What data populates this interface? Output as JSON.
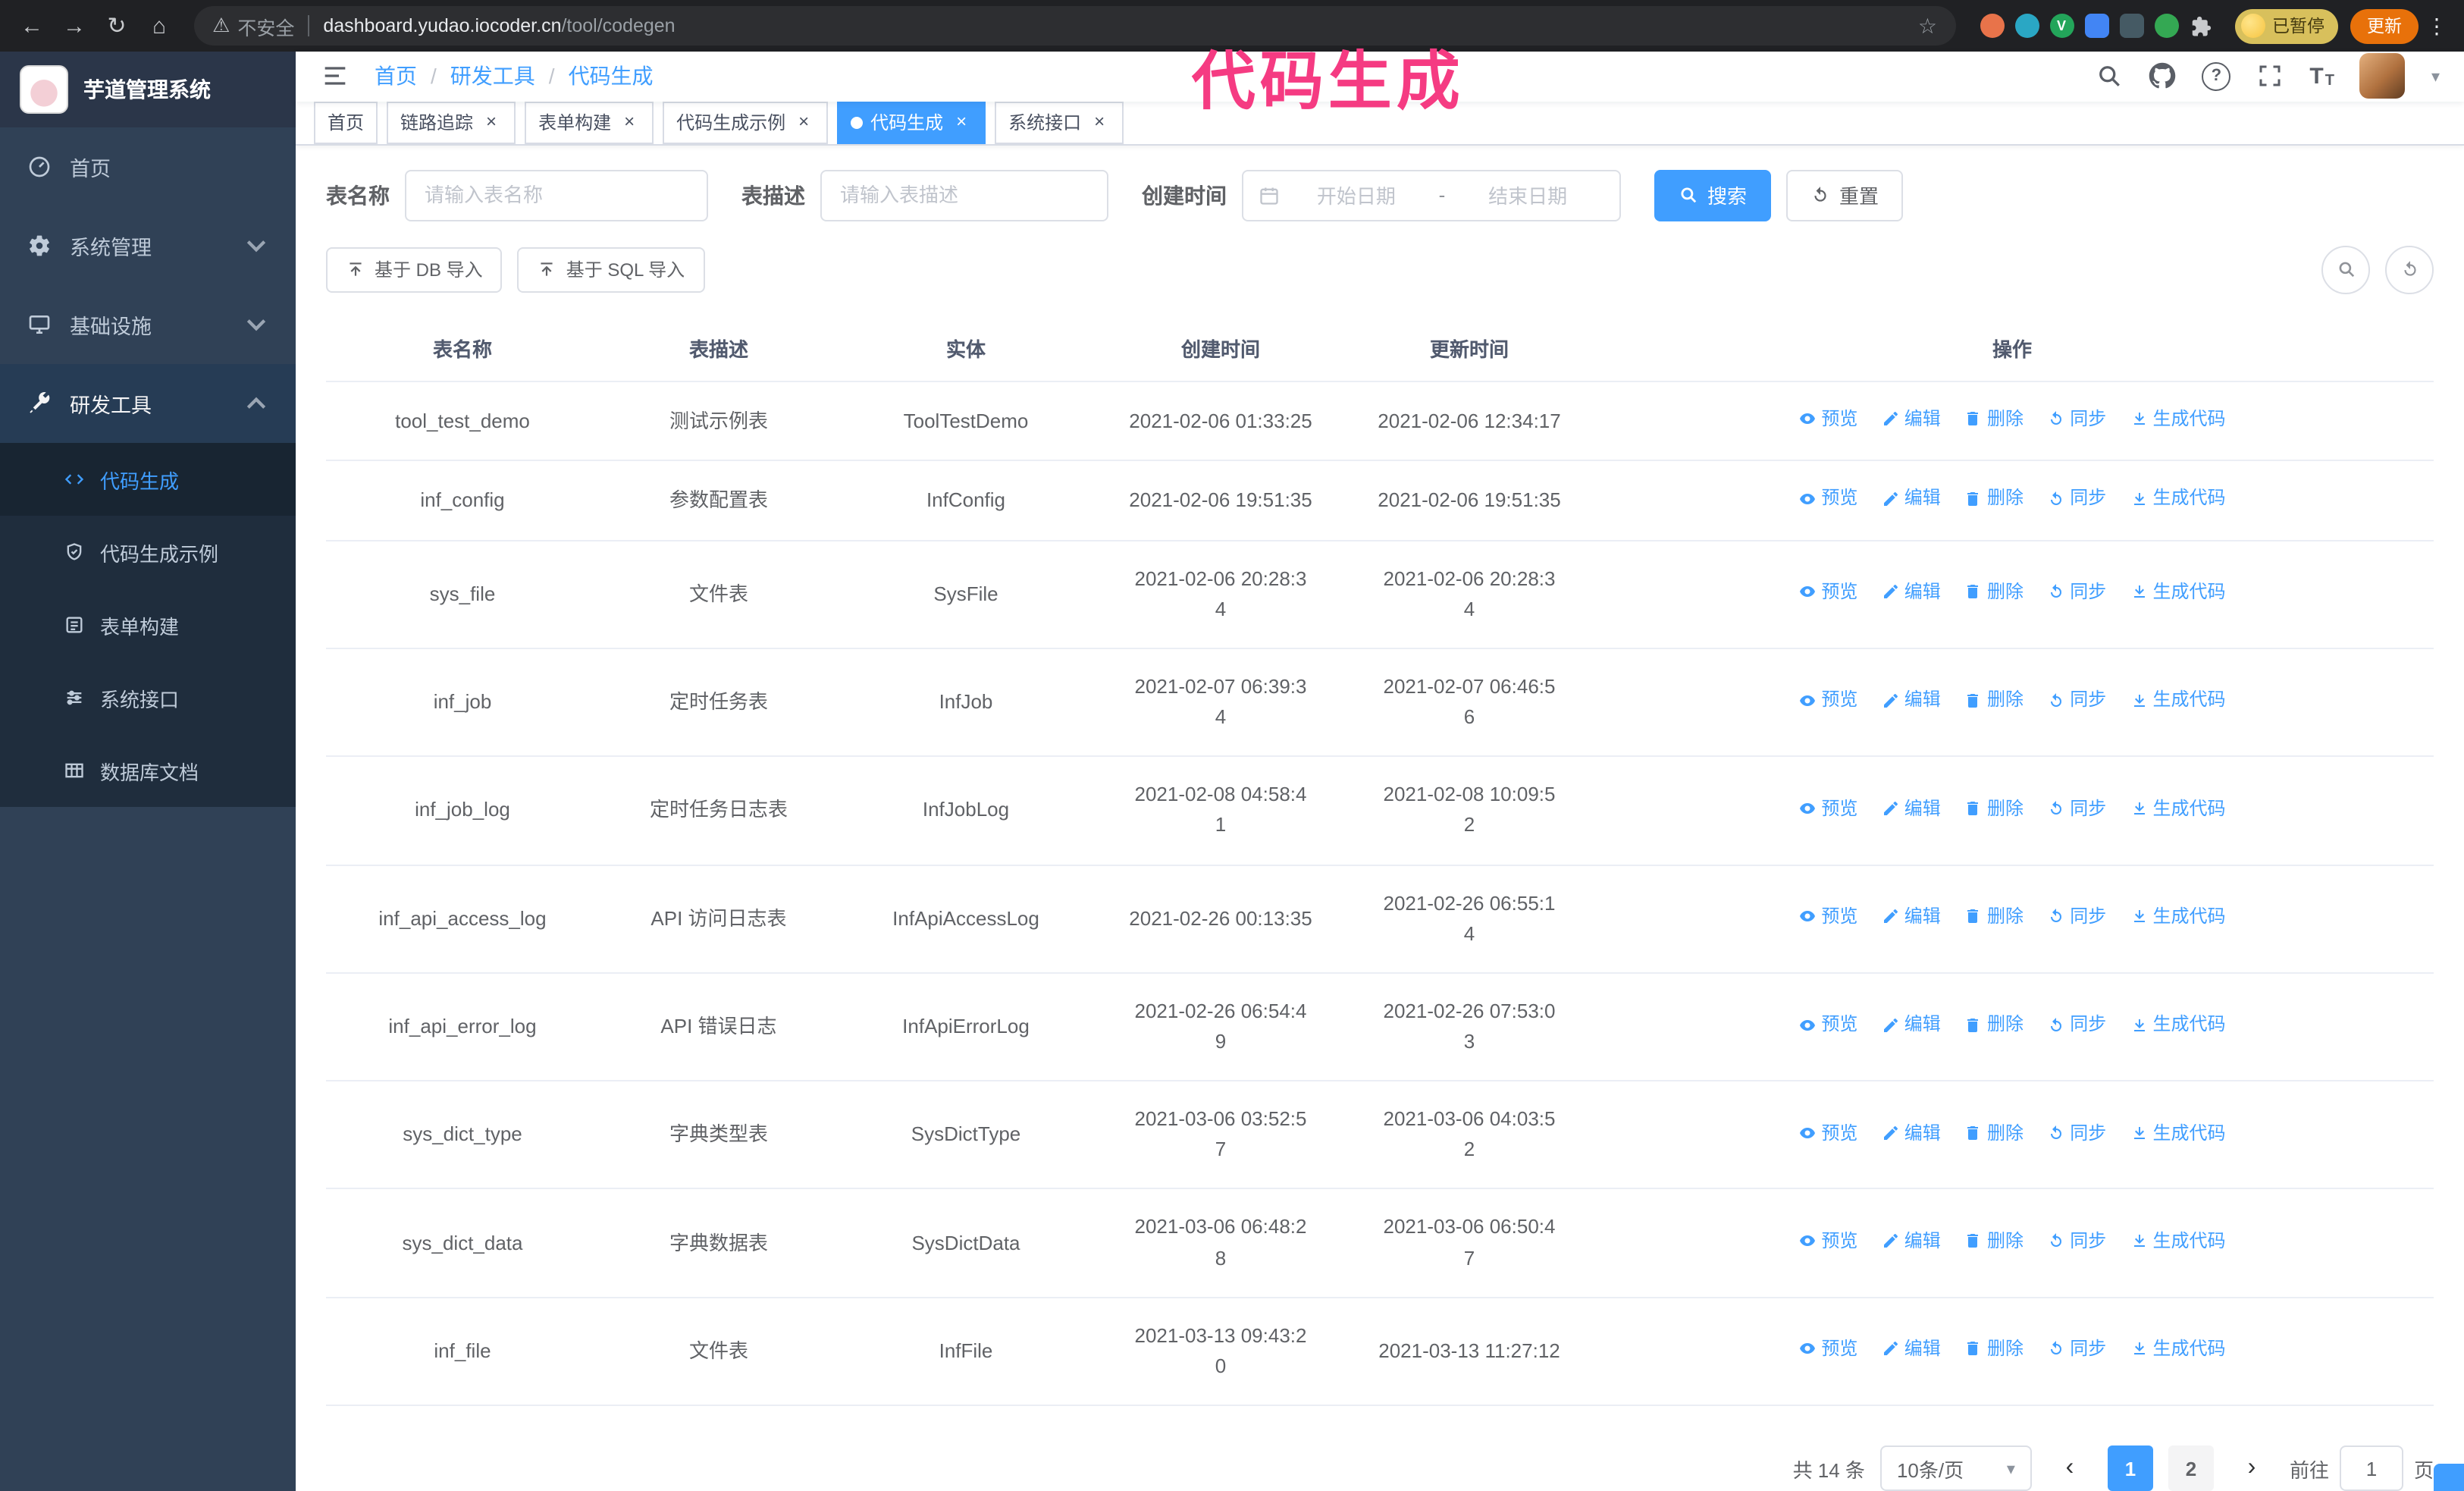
{
  "colors": {
    "primary": "#409eff",
    "sidebar_bg": "#304156",
    "sidebar_submenu_bg": "#1f2d3d",
    "tag_active_bg": "#409eff",
    "update_button_bg": "#e8710a"
  },
  "annotation": {
    "text": "代码生成",
    "color": "#f53b82"
  },
  "browser": {
    "security_label": "不安全",
    "url_host": "dashboard.yudao.iocoder.cn",
    "url_path": "/tool/codegen",
    "paused_badge": "已暂停",
    "update_button": "更新"
  },
  "sidebar": {
    "logo_title": "芋道管理系统",
    "items": [
      {
        "label": "首页"
      },
      {
        "label": "系统管理"
      },
      {
        "label": "基础设施"
      },
      {
        "label": "研发工具"
      }
    ],
    "sub_items": [
      {
        "label": "代码生成",
        "active": true
      },
      {
        "label": "代码生成示例",
        "active": false
      },
      {
        "label": "表单构建",
        "active": false
      },
      {
        "label": "系统接口",
        "active": false
      },
      {
        "label": "数据库文档",
        "active": false
      }
    ]
  },
  "header": {
    "breadcrumb": [
      "首页",
      "研发工具",
      "代码生成"
    ],
    "breadcrumb_separator": "/"
  },
  "tags": [
    {
      "label": "首页",
      "closable": false,
      "active": false
    },
    {
      "label": "链路追踪",
      "closable": true,
      "active": false
    },
    {
      "label": "表单构建",
      "closable": true,
      "active": false
    },
    {
      "label": "代码生成示例",
      "closable": true,
      "active": false
    },
    {
      "label": "代码生成",
      "closable": true,
      "active": true
    },
    {
      "label": "系统接口",
      "closable": true,
      "active": false
    }
  ],
  "search": {
    "name_label": "表名称",
    "name_placeholder": "请输入表名称",
    "desc_label": "表描述",
    "desc_placeholder": "请输入表描述",
    "time_label": "创建时间",
    "start_placeholder": "开始日期",
    "range_separator": "-",
    "end_placeholder": "结束日期",
    "search_button": "搜索",
    "reset_button": "重置"
  },
  "toolbar": {
    "import_db_button": "基于 DB 导入",
    "import_sql_button": "基于 SQL 导入"
  },
  "table": {
    "columns": [
      "表名称",
      "表描述",
      "实体",
      "创建时间",
      "更新时间",
      "操作"
    ],
    "action_labels": [
      "预览",
      "编辑",
      "删除",
      "同步",
      "生成代码"
    ],
    "rows": [
      {
        "name": "tool_test_demo",
        "desc": "测试示例表",
        "entity": "ToolTestDemo",
        "created": "2021-02-06 01:33:25",
        "updated": "2021-02-06 12:34:17"
      },
      {
        "name": "inf_config",
        "desc": "参数配置表",
        "entity": "InfConfig",
        "created": "2021-02-06 19:51:35",
        "updated": "2021-02-06 19:51:35"
      },
      {
        "name": "sys_file",
        "desc": "文件表",
        "entity": "SysFile",
        "created": "2021-02-06 20:28:3\n4",
        "updated": "2021-02-06 20:28:3\n4"
      },
      {
        "name": "inf_job",
        "desc": "定时任务表",
        "entity": "InfJob",
        "created": "2021-02-07 06:39:3\n4",
        "updated": "2021-02-07 06:46:5\n6"
      },
      {
        "name": "inf_job_log",
        "desc": "定时任务日志表",
        "entity": "InfJobLog",
        "created": "2021-02-08 04:58:4\n1",
        "updated": "2021-02-08 10:09:5\n2"
      },
      {
        "name": "inf_api_access_log",
        "desc": "API 访问日志表",
        "entity": "InfApiAccessLog",
        "created": "2021-02-26 00:13:35",
        "updated": "2021-02-26 06:55:1\n4"
      },
      {
        "name": "inf_api_error_log",
        "desc": "API 错误日志",
        "entity": "InfApiErrorLog",
        "created": "2021-02-26 06:54:4\n9",
        "updated": "2021-02-26 07:53:0\n3"
      },
      {
        "name": "sys_dict_type",
        "desc": "字典类型表",
        "entity": "SysDictType",
        "created": "2021-03-06 03:52:5\n7",
        "updated": "2021-03-06 04:03:5\n2"
      },
      {
        "name": "sys_dict_data",
        "desc": "字典数据表",
        "entity": "SysDictData",
        "created": "2021-03-06 06:48:2\n8",
        "updated": "2021-03-06 06:50:4\n7"
      },
      {
        "name": "inf_file",
        "desc": "文件表",
        "entity": "InfFile",
        "created": "2021-03-13 09:43:2\n0",
        "updated": "2021-03-13 11:27:12"
      }
    ]
  },
  "pagination": {
    "total_label": "共 14 条",
    "page_size_label": "10条/页",
    "pages": [
      {
        "label": "1",
        "active": true
      },
      {
        "label": "2",
        "active": false
      }
    ],
    "goto_label": "前往",
    "goto_value": "1",
    "goto_suffix_label": "页"
  }
}
